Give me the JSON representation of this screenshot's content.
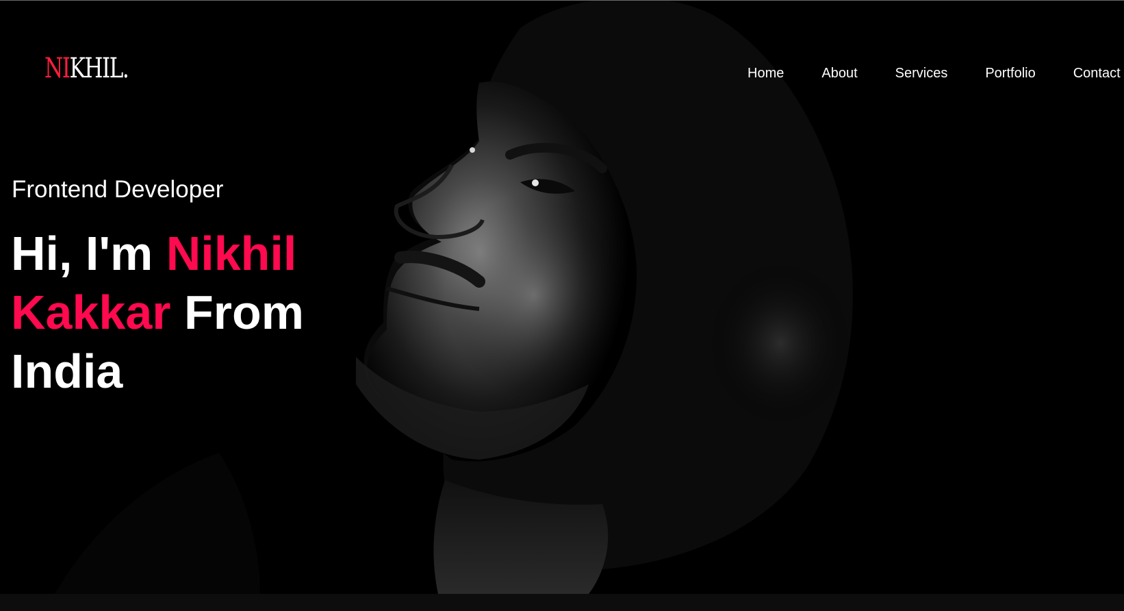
{
  "brand": {
    "logo_accent": "NI",
    "logo_rest": "KHIL.",
    "accent_color": "#ff1e3c"
  },
  "nav": {
    "items": [
      {
        "label": "Home"
      },
      {
        "label": "About"
      },
      {
        "label": "Services"
      },
      {
        "label": "Portfolio"
      },
      {
        "label": "Contact"
      }
    ]
  },
  "hero": {
    "role": "Frontend Developer",
    "greeting": "Hi, I'm",
    "name_first": "Nikhil",
    "name_last": "Kakkar",
    "from_word": "From",
    "country": "India",
    "highlight_color": "#ff0a4f",
    "image": "portrait-photo"
  }
}
